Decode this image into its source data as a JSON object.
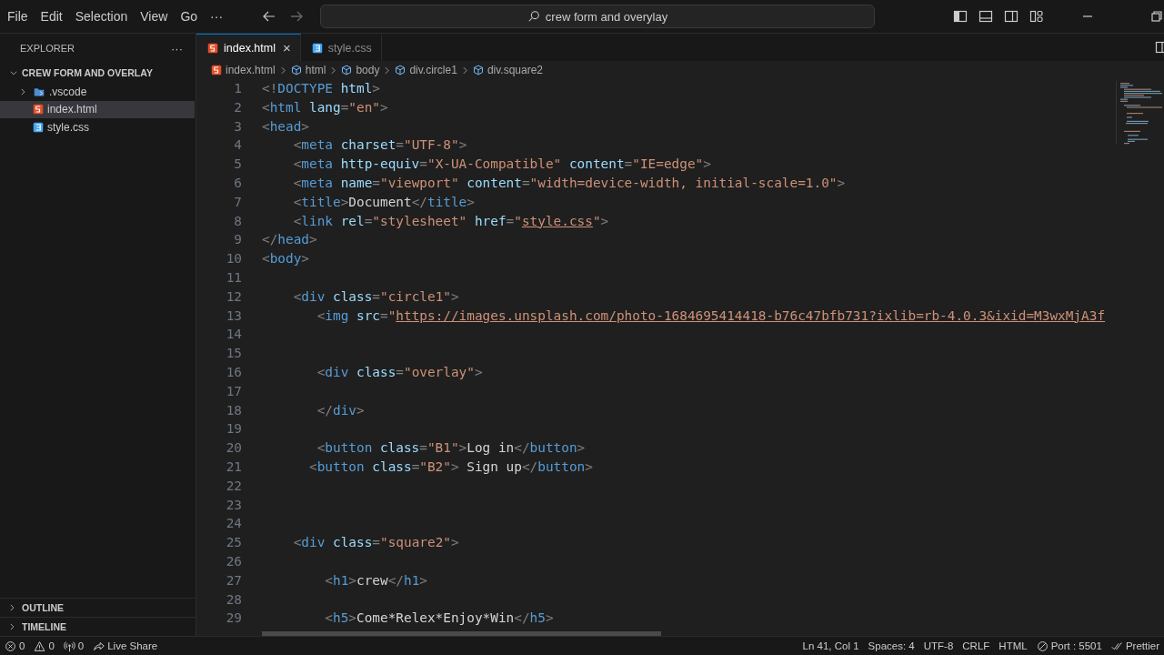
{
  "menu": [
    "File",
    "Edit",
    "Selection",
    "View",
    "Go",
    "···"
  ],
  "search": {
    "value": "crew form and overylay"
  },
  "explorer": {
    "title": "EXPLORER",
    "more": "···",
    "folder": {
      "name": "CREW FORM AND OVERLAY",
      "expanded": true,
      "children": [
        {
          "name": ".vscode",
          "kind": "folder",
          "expanded": false,
          "selected": false
        },
        {
          "name": "index.html",
          "kind": "html",
          "selected": true
        },
        {
          "name": "style.css",
          "kind": "css",
          "selected": false
        }
      ]
    }
  },
  "sections": [
    {
      "name": "OUTLINE",
      "expanded": false
    },
    {
      "name": "TIMELINE",
      "expanded": false
    }
  ],
  "tabs": [
    {
      "label": "index.html",
      "kind": "html",
      "selected": true,
      "close": "×"
    },
    {
      "label": "style.css",
      "kind": "css",
      "selected": false
    }
  ],
  "breadcrumbs": [
    {
      "label": "index.html",
      "kind": "file"
    },
    {
      "label": "html",
      "kind": "element"
    },
    {
      "label": "body",
      "kind": "element"
    },
    {
      "label": "div.circle1",
      "kind": "element"
    },
    {
      "label": "div.square2",
      "kind": "element"
    }
  ],
  "code": [
    {
      "number": "1",
      "tokens": [
        {
          "kind": "punct",
          "text": "<!"
        },
        {
          "kind": "tag",
          "text": "DOCTYPE"
        },
        {
          "kind": "attr",
          "text": " html"
        },
        {
          "kind": "punct",
          "text": ">"
        }
      ]
    },
    {
      "number": "2",
      "tokens": [
        {
          "kind": "punct",
          "text": "<"
        },
        {
          "kind": "tag",
          "text": "html"
        },
        {
          "kind": "attr",
          "text": " lang"
        },
        {
          "kind": "punct",
          "text": "="
        },
        {
          "kind": "string",
          "text": "\"en\""
        },
        {
          "kind": "punct",
          "text": ">"
        }
      ]
    },
    {
      "number": "3",
      "tokens": [
        {
          "kind": "punct",
          "text": "<"
        },
        {
          "kind": "tag",
          "text": "head"
        },
        {
          "kind": "punct",
          "text": ">"
        }
      ]
    },
    {
      "number": "4",
      "tokens": [
        {
          "kind": "punct",
          "text": "    <"
        },
        {
          "kind": "tag",
          "text": "meta"
        },
        {
          "kind": "attr",
          "text": " charset"
        },
        {
          "kind": "punct",
          "text": "="
        },
        {
          "kind": "string",
          "text": "\"UTF-8\""
        },
        {
          "kind": "punct",
          "text": ">"
        }
      ]
    },
    {
      "number": "5",
      "tokens": [
        {
          "kind": "punct",
          "text": "    <"
        },
        {
          "kind": "tag",
          "text": "meta"
        },
        {
          "kind": "attr",
          "text": " http-equiv"
        },
        {
          "kind": "punct",
          "text": "="
        },
        {
          "kind": "string",
          "text": "\"X-UA-Compatible\""
        },
        {
          "kind": "attr",
          "text": " content"
        },
        {
          "kind": "punct",
          "text": "="
        },
        {
          "kind": "string",
          "text": "\"IE=edge\""
        },
        {
          "kind": "punct",
          "text": ">"
        }
      ]
    },
    {
      "number": "6",
      "tokens": [
        {
          "kind": "punct",
          "text": "    <"
        },
        {
          "kind": "tag",
          "text": "meta"
        },
        {
          "kind": "attr",
          "text": " name"
        },
        {
          "kind": "punct",
          "text": "="
        },
        {
          "kind": "string",
          "text": "\"viewport\""
        },
        {
          "kind": "attr",
          "text": " content"
        },
        {
          "kind": "punct",
          "text": "="
        },
        {
          "kind": "string",
          "text": "\"width=device-width, initial-scale=1.0\""
        },
        {
          "kind": "punct",
          "text": ">"
        }
      ]
    },
    {
      "number": "7",
      "tokens": [
        {
          "kind": "punct",
          "text": "    <"
        },
        {
          "kind": "tag",
          "text": "title"
        },
        {
          "kind": "punct",
          "text": ">"
        },
        {
          "kind": "text",
          "text": "Document"
        },
        {
          "kind": "punct",
          "text": "</"
        },
        {
          "kind": "tag",
          "text": "title"
        },
        {
          "kind": "punct",
          "text": ">"
        }
      ]
    },
    {
      "number": "8",
      "tokens": [
        {
          "kind": "punct",
          "text": "    <"
        },
        {
          "kind": "tag",
          "text": "link"
        },
        {
          "kind": "attr",
          "text": " rel"
        },
        {
          "kind": "punct",
          "text": "="
        },
        {
          "kind": "string",
          "text": "\"stylesheet\""
        },
        {
          "kind": "attr",
          "text": " href"
        },
        {
          "kind": "punct",
          "text": "="
        },
        {
          "kind": "string",
          "text": "\""
        },
        {
          "kind": "link",
          "text": "style.css"
        },
        {
          "kind": "string",
          "text": "\""
        },
        {
          "kind": "punct",
          "text": ">"
        }
      ]
    },
    {
      "number": "9",
      "tokens": [
        {
          "kind": "punct",
          "text": "</"
        },
        {
          "kind": "tag",
          "text": "head"
        },
        {
          "kind": "punct",
          "text": ">"
        }
      ]
    },
    {
      "number": "10",
      "tokens": [
        {
          "kind": "punct",
          "text": "<"
        },
        {
          "kind": "tag",
          "text": "body"
        },
        {
          "kind": "punct",
          "text": ">"
        }
      ]
    },
    {
      "number": "11"
    },
    {
      "number": "12",
      "tokens": [
        {
          "kind": "punct",
          "text": "    <"
        },
        {
          "kind": "tag",
          "text": "div"
        },
        {
          "kind": "attr",
          "text": " class"
        },
        {
          "kind": "punct",
          "text": "="
        },
        {
          "kind": "string",
          "text": "\"circle1\""
        },
        {
          "kind": "punct",
          "text": ">"
        }
      ]
    },
    {
      "number": "13",
      "tokens": [
        {
          "kind": "punct",
          "text": "       <"
        },
        {
          "kind": "tag",
          "text": "img"
        },
        {
          "kind": "attr",
          "text": " src"
        },
        {
          "kind": "punct",
          "text": "="
        },
        {
          "kind": "string",
          "text": "\""
        },
        {
          "kind": "link",
          "text": "https://images.unsplash.com/photo-1684695414418-b76c47bfb731?ixlib=rb-4.0.3&ixid=M3wxMjA3f"
        }
      ]
    },
    {
      "number": "14"
    },
    {
      "number": "15"
    },
    {
      "number": "16",
      "tokens": [
        {
          "kind": "punct",
          "text": "       <"
        },
        {
          "kind": "tag",
          "text": "div"
        },
        {
          "kind": "attr",
          "text": " class"
        },
        {
          "kind": "punct",
          "text": "="
        },
        {
          "kind": "string",
          "text": "\"overlay\""
        },
        {
          "kind": "punct",
          "text": ">"
        }
      ]
    },
    {
      "number": "17"
    },
    {
      "number": "18",
      "tokens": [
        {
          "kind": "punct",
          "text": "       </"
        },
        {
          "kind": "tag",
          "text": "div"
        },
        {
          "kind": "punct",
          "text": ">"
        }
      ]
    },
    {
      "number": "19"
    },
    {
      "number": "20",
      "tokens": [
        {
          "kind": "punct",
          "text": "       <"
        },
        {
          "kind": "tag",
          "text": "button"
        },
        {
          "kind": "attr",
          "text": " class"
        },
        {
          "kind": "punct",
          "text": "="
        },
        {
          "kind": "string",
          "text": "\"B1\""
        },
        {
          "kind": "punct",
          "text": ">"
        },
        {
          "kind": "text",
          "text": "Log in"
        },
        {
          "kind": "punct",
          "text": "</"
        },
        {
          "kind": "tag",
          "text": "button"
        },
        {
          "kind": "punct",
          "text": ">"
        }
      ]
    },
    {
      "number": "21",
      "tokens": [
        {
          "kind": "punct",
          "text": "      <"
        },
        {
          "kind": "tag",
          "text": "button"
        },
        {
          "kind": "attr",
          "text": " class"
        },
        {
          "kind": "punct",
          "text": "="
        },
        {
          "kind": "string",
          "text": "\"B2\""
        },
        {
          "kind": "punct",
          "text": ">"
        },
        {
          "kind": "text",
          "text": " Sign up"
        },
        {
          "kind": "punct",
          "text": "</"
        },
        {
          "kind": "tag",
          "text": "button"
        },
        {
          "kind": "punct",
          "text": ">"
        }
      ]
    },
    {
      "number": "22"
    },
    {
      "number": "23"
    },
    {
      "number": "24"
    },
    {
      "number": "25",
      "tokens": [
        {
          "kind": "punct",
          "text": "    <"
        },
        {
          "kind": "tag",
          "text": "div"
        },
        {
          "kind": "attr",
          "text": " class"
        },
        {
          "kind": "punct",
          "text": "="
        },
        {
          "kind": "string",
          "text": "\"square2\""
        },
        {
          "kind": "punct",
          "text": ">"
        }
      ]
    },
    {
      "number": "26"
    },
    {
      "number": "27",
      "tokens": [
        {
          "kind": "punct",
          "text": "        <"
        },
        {
          "kind": "tag",
          "text": "h1"
        },
        {
          "kind": "punct",
          "text": ">"
        },
        {
          "kind": "text",
          "text": "crew"
        },
        {
          "kind": "punct",
          "text": "</"
        },
        {
          "kind": "tag",
          "text": "h1"
        },
        {
          "kind": "punct",
          "text": ">"
        }
      ]
    },
    {
      "number": "28"
    },
    {
      "number": "29",
      "tokens": [
        {
          "kind": "punct",
          "text": "        <"
        },
        {
          "kind": "tag",
          "text": "h5"
        },
        {
          "kind": "punct",
          "text": ">"
        },
        {
          "kind": "text",
          "text": "Come*Relex*Enjoy*Win"
        },
        {
          "kind": "punct",
          "text": "</"
        },
        {
          "kind": "tag",
          "text": "h5"
        },
        {
          "kind": "punct",
          "text": ">"
        }
      ]
    }
  ],
  "status": {
    "left": [
      {
        "kind": "errors",
        "text": "0"
      },
      {
        "kind": "warnings",
        "text": "0"
      },
      {
        "kind": "ports",
        "text": "0"
      },
      {
        "kind": "share",
        "text": "Live Share"
      }
    ],
    "right": [
      {
        "kind": "plain",
        "text": "Ln 41, Col 1"
      },
      {
        "kind": "plain",
        "text": "Spaces: 4"
      },
      {
        "kind": "plain",
        "text": "UTF-8"
      },
      {
        "kind": "plain",
        "text": "CRLF"
      },
      {
        "kind": "plain",
        "text": "HTML"
      },
      {
        "kind": "port",
        "text": "Port : 5501"
      },
      {
        "kind": "prettier",
        "text": "Prettier"
      }
    ]
  }
}
